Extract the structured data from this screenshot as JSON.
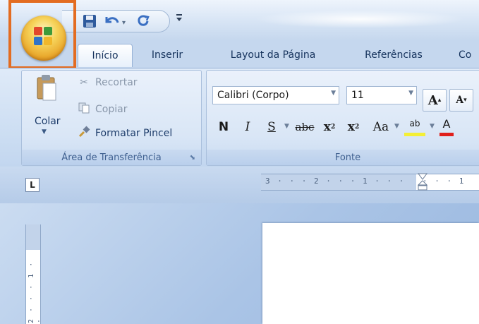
{
  "quick_access": {
    "save_icon": "save-icon",
    "undo_icon": "undo-icon",
    "redo_icon": "redo-icon",
    "customize_icon": "customize-qat-icon"
  },
  "tabs": [
    {
      "label": "Início",
      "active": true
    },
    {
      "label": "Inserir",
      "active": false
    },
    {
      "label": "Layout da Página",
      "active": false
    },
    {
      "label": "Referências",
      "active": false
    },
    {
      "label": "Co",
      "active": false
    }
  ],
  "clipboard": {
    "paste_label": "Colar",
    "cut_label": "Recortar",
    "copy_label": "Copiar",
    "format_painter_label": "Formatar Pincel",
    "group_label": "Área de Transferência"
  },
  "font": {
    "font_name": "Calibri (Corpo)",
    "font_size": "11",
    "grow_label": "A",
    "shrink_label": "A",
    "bold_label": "N",
    "italic_label": "I",
    "underline_label": "S",
    "strike_label": "abc",
    "subscript_label": "x",
    "superscript_label": "x",
    "case_label": "Aa",
    "highlight_label": "ab",
    "group_label": "Fonte"
  },
  "ruler": {
    "horizontal_text": "3 · · · 2 · · · 1 · · · ",
    "horizontal_after": "· · · 1",
    "vertical_text": "2 · · · 1 · ·"
  },
  "colors": {
    "highlight_border": "#e36c21",
    "ribbon_text": "#1e3d6b"
  }
}
